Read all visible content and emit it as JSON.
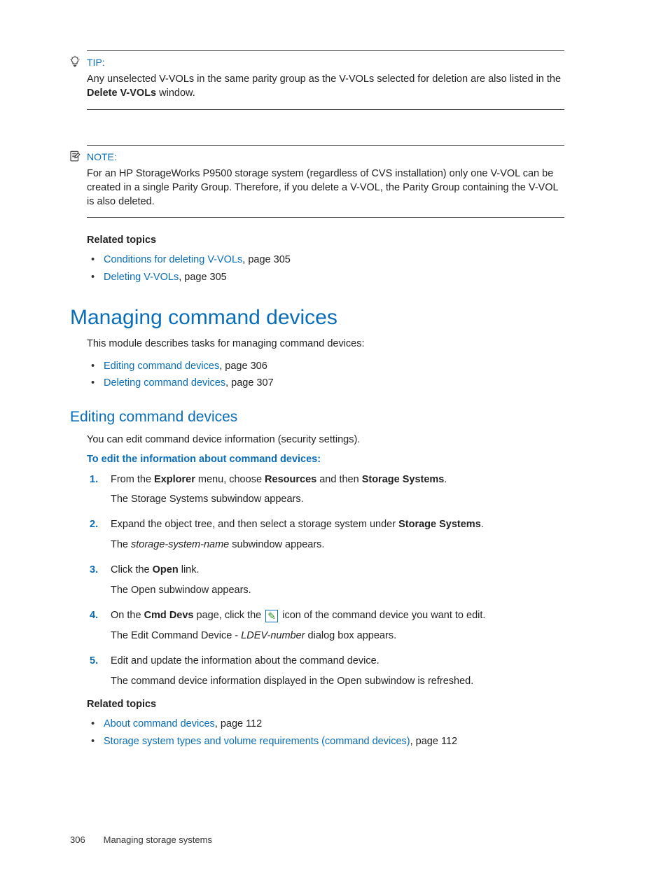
{
  "tip": {
    "label": "TIP:",
    "body_pre": "Any unselected V-VOLs in the same parity group as the V-VOLs selected for deletion are also listed in the ",
    "body_bold": "Delete V-VOLs",
    "body_post": " window."
  },
  "note": {
    "label": "NOTE:",
    "body": "For an HP StorageWorks P9500 storage system (regardless of CVS installation) only one V-VOL can be created in a single Parity Group. Therefore, if you delete a V-VOL, the Parity Group containing the V-VOL is also deleted."
  },
  "related1": {
    "heading": "Related topics",
    "items": [
      {
        "link": "Conditions for deleting V-VOLs",
        "suffix": ", page 305"
      },
      {
        "link": "Deleting V-VOLs",
        "suffix": ", page 305"
      }
    ]
  },
  "h1": "Managing command devices",
  "intro": "This module describes tasks for managing command devices:",
  "toc": [
    {
      "link": "Editing command devices",
      "suffix": ", page 306"
    },
    {
      "link": "Deleting command devices",
      "suffix": ", page 307"
    }
  ],
  "h2": "Editing command devices",
  "h2_intro": "You can edit command device information (security settings).",
  "procedure_intro": "To edit the information about command devices:",
  "steps": {
    "s1": {
      "pre": "From the ",
      "b1": "Explorer",
      "mid1": " menu, choose ",
      "b2": "Resources",
      "mid2": " and then ",
      "b3": "Storage Systems",
      "post": ".",
      "sub": "The Storage Systems subwindow appears."
    },
    "s2": {
      "pre": "Expand the object tree, and then select a storage system under ",
      "b1": "Storage Systems",
      "post": ".",
      "sub_pre": "The ",
      "sub_i": "storage-system-name",
      "sub_post": " subwindow appears."
    },
    "s3": {
      "pre": "Click the ",
      "b1": "Open",
      "post": " link.",
      "sub": "The Open subwindow appears."
    },
    "s4": {
      "pre": "On the ",
      "b1": "Cmd Devs",
      "mid": " page, click the ",
      "post": " icon of the command device you want to edit.",
      "sub_pre": "The Edit Command Device - ",
      "sub_i": " LDEV-number ",
      "sub_post": " dialog box appears."
    },
    "s5": {
      "main": "Edit and update the information about the command device.",
      "sub": "The command device information displayed in the Open subwindow is refreshed."
    }
  },
  "related2": {
    "heading": "Related topics",
    "items": [
      {
        "link": "About command devices",
        "suffix": ", page 112"
      },
      {
        "link": "Storage system types and volume requirements (command devices)",
        "suffix": ", page 112"
      }
    ]
  },
  "footer": {
    "page": "306",
    "title": "Managing storage systems"
  }
}
